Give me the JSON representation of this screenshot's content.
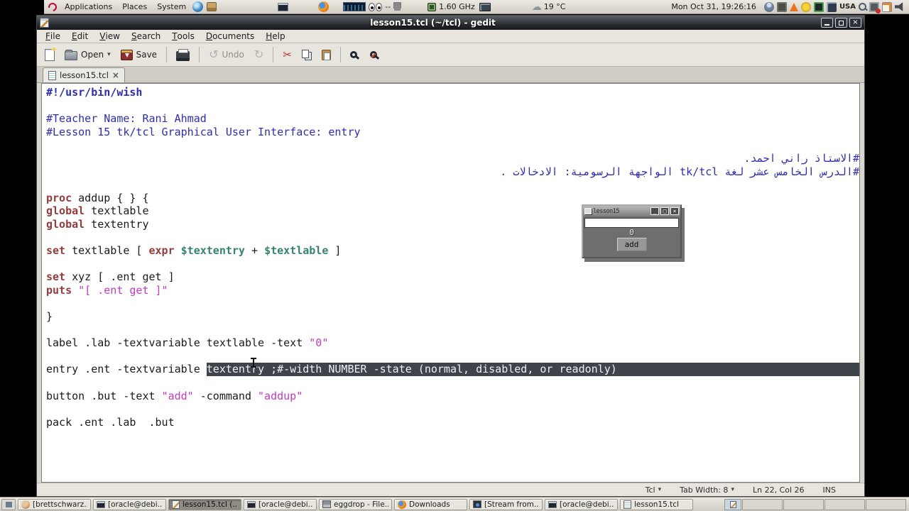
{
  "top_panel": {
    "menus": [
      "Applications",
      "Places",
      "System"
    ],
    "launcher_icons": [
      "globe-icon",
      "package-icon"
    ],
    "terminal_icon": "terminal-icon",
    "firefox_icon": "firefox-icon",
    "monitor_dashes": "--",
    "cpu_freq": "1.60 GHz",
    "temperature": "19 °C",
    "clock": "Mon Oct 31, 19:26:16",
    "keyboard_layout": "USA",
    "tray_icons": [
      "user-icon",
      "camera-icon",
      "cone-icon",
      "gear-icon",
      "battery-icon",
      "display-icon",
      "keyboard-layout-label",
      "magnifier-icon",
      "battery-alert-icon",
      "note-icon",
      "volume-icon"
    ]
  },
  "window": {
    "title": "lesson15.tcl (~/tcl) - gedit",
    "menu_items": [
      "File",
      "Edit",
      "View",
      "Search",
      "Tools",
      "Documents",
      "Help"
    ],
    "toolbar": {
      "open_label": "Open",
      "save_label": "Save",
      "undo_label": "Undo"
    },
    "tab": {
      "label": "lesson15.tcl",
      "close": "×"
    },
    "controls": {
      "close": "×"
    }
  },
  "editor": {
    "lines": [
      {
        "s": [
          [
            "cmb",
            "#!/usr/bin/wish"
          ]
        ]
      },
      {},
      {
        "s": [
          [
            "cm",
            "#Teacher Name: Rani Ahmad"
          ]
        ]
      },
      {
        "s": [
          [
            "cm",
            "#Lesson 15 tk/tcl Graphical User Interface: entry"
          ]
        ]
      },
      {},
      {
        "rtl": true,
        "s": [
          [
            "cm",
            "#الاستاذ راني احمد."
          ]
        ]
      },
      {
        "rtl": true,
        "s": [
          [
            "cm",
            "#الدرس الخامس عشر لغة tk/tcl الواجهة الرسومية: الادخالات ."
          ]
        ]
      },
      {},
      {
        "s": [
          [
            "kw",
            "proc"
          ],
          [
            "pl",
            " addup { } {"
          ]
        ]
      },
      {
        "s": [
          [
            "kw",
            "global"
          ],
          [
            "pl",
            " textlable"
          ]
        ]
      },
      {
        "s": [
          [
            "kw",
            "global"
          ],
          [
            "pl",
            " textentry"
          ]
        ]
      },
      {},
      {
        "s": [
          [
            "kw",
            "set"
          ],
          [
            "pl",
            " textlable [ "
          ],
          [
            "kw",
            "expr"
          ],
          [
            "pl",
            " "
          ],
          [
            "vr",
            "$textentry"
          ],
          [
            "pl",
            " + "
          ],
          [
            "vr",
            "$textlable"
          ],
          [
            "pl",
            " ]"
          ]
        ]
      },
      {},
      {
        "s": [
          [
            "kw",
            "set"
          ],
          [
            "pl",
            " xyz [ .ent get ]"
          ]
        ]
      },
      {
        "s": [
          [
            "kw",
            "puts"
          ],
          [
            "pl",
            " "
          ],
          [
            "st",
            "\"[ .ent get ]\""
          ]
        ]
      },
      {},
      {
        "s": [
          [
            "pl",
            "}"
          ]
        ]
      },
      {},
      {
        "s": [
          [
            "pl",
            "label .lab -textvariable textlable -text "
          ],
          [
            "st",
            "\"0\""
          ]
        ]
      },
      {},
      {
        "ext": true,
        "s": [
          [
            "pl",
            "entry .ent -textvariable "
          ],
          [
            "sel",
            "textentry ;#-width NUMBER -state (normal, disabled, or readonly)"
          ]
        ]
      },
      {},
      {
        "s": [
          [
            "pl",
            "button .but -text "
          ],
          [
            "st",
            "\"add\""
          ],
          [
            "pl",
            " -command "
          ],
          [
            "st",
            "\"addup\""
          ]
        ]
      },
      {},
      {
        "s": [
          [
            "pl",
            "pack .ent .lab  .but"
          ]
        ]
      }
    ]
  },
  "tk_window": {
    "title": "lesson15",
    "min": "_",
    "max": "□",
    "close": "×",
    "entry_value": "",
    "label_value": "0",
    "button_label": "add"
  },
  "status_bar": {
    "language": "Tcl",
    "tab_width": "Tab Width: 8",
    "position": "Ln 22, Col 26",
    "mode": "INS",
    "chevron": "▾"
  },
  "taskbar": {
    "items": [
      {
        "icon": "round-app-icon",
        "cls": "ti-round",
        "label": "[brettschwarz...",
        "active": false
      },
      {
        "icon": "terminal-icon",
        "cls": "ti-term",
        "label": "[oracle@debi...",
        "active": false
      },
      {
        "icon": "gedit-icon",
        "cls": "ti-gedit",
        "label": "lesson15.tcl (...",
        "active": true
      },
      {
        "icon": "terminal-icon",
        "cls": "ti-term",
        "label": "[oracle@debi...",
        "active": false
      },
      {
        "icon": "file-manager-icon",
        "cls": "ti-file",
        "label": "eggdrop - File...",
        "active": false
      },
      {
        "icon": "firefox-icon",
        "cls": "ti-ff",
        "label": "Downloads",
        "active": false
      },
      {
        "icon": "media-icon",
        "cls": "ti-media",
        "label": "[Stream from...",
        "active": false
      },
      {
        "icon": "terminal-icon",
        "cls": "ti-term",
        "label": "[oracle@debi...",
        "active": false
      },
      {
        "icon": "document-icon",
        "cls": "ti-doc",
        "label": "lesson15.tcl",
        "active": false
      }
    ],
    "workspace_count": 4
  }
}
